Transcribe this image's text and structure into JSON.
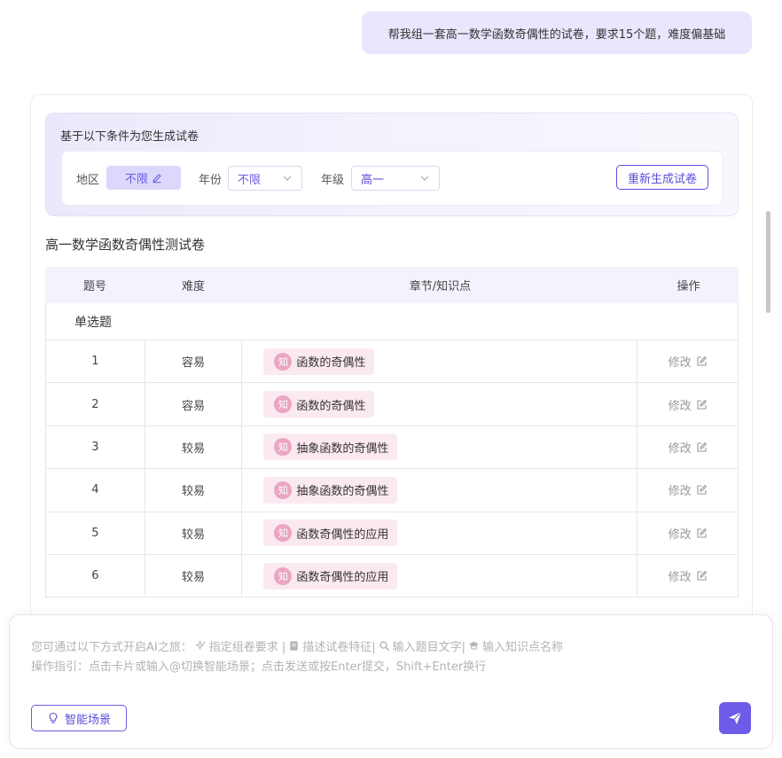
{
  "user_message": "帮我组一套高一数学函数奇偶性的试卷，要求15个题，难度偏基础",
  "conditions": {
    "title": "基于以下条件为您生成试卷",
    "region_label": "地区",
    "region_value": "不限",
    "year_label": "年份",
    "year_value": "不限",
    "grade_label": "年级",
    "grade_value": "高一",
    "regenerate_label": "重新生成试卷"
  },
  "paper": {
    "title": "高一数学函数奇偶性测试卷",
    "headers": [
      "题号",
      "难度",
      "章节/知识点",
      "操作"
    ],
    "section": "单选题",
    "badge_char": "知",
    "edit_label": "修改",
    "rows": [
      {
        "no": "1",
        "difficulty": "容易",
        "knowledge": "函数的奇偶性"
      },
      {
        "no": "2",
        "difficulty": "容易",
        "knowledge": "函数的奇偶性"
      },
      {
        "no": "3",
        "difficulty": "较易",
        "knowledge": "抽象函数的奇偶性"
      },
      {
        "no": "4",
        "difficulty": "较易",
        "knowledge": "抽象函数的奇偶性"
      },
      {
        "no": "5",
        "difficulty": "较易",
        "knowledge": "函数奇偶性的应用"
      },
      {
        "no": "6",
        "difficulty": "较易",
        "knowledge": "函数奇偶性的应用"
      }
    ]
  },
  "input": {
    "hint_prefix": "您可通过以下方式开启AI之旅：",
    "hint_items": [
      "指定组卷要求 |",
      "描述试卷特征|",
      "输入题目文字|",
      "输入知识点名称"
    ],
    "hint_line2": "操作指引：点击卡片或输入@切换智能场景；点击发送或按Enter提交，Shift+Enter换行",
    "scene_button": "智能场景"
  },
  "colors": {
    "accent": "#6c5ce7",
    "bubble": "#e9e6fd",
    "tag_bg": "#fbe9f1"
  }
}
